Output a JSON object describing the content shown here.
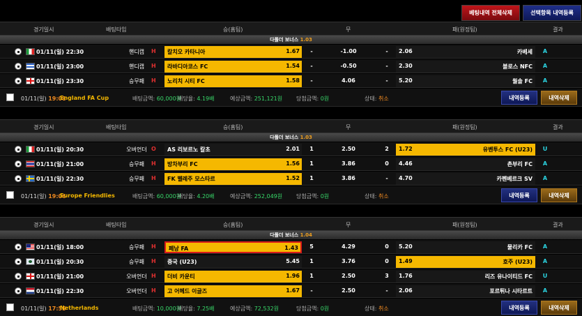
{
  "top_buttons": {
    "delete_all": "베팅내역 전체삭제",
    "register_selected": "선택항목 내역등록"
  },
  "header": {
    "date": "경기일시",
    "bet_type": "배팅타입",
    "home": "승(홈팀)",
    "draw": "무",
    "away": "패(원정팀)",
    "result": "결과"
  },
  "slips": [
    {
      "bonus_label": "다폴더 보너스",
      "bonus_value": "1.03",
      "rows": [
        {
          "flag": "it",
          "time": "01/11(일) 22:30",
          "type": "핸디캡",
          "mark": "H",
          "home": "칼치오 카타니아",
          "home_odds": "1.67",
          "mid1": "-",
          "draw": "-1.00",
          "mid2": "-",
          "away_odds": "2.06",
          "away": "카베세",
          "result": "A",
          "pick": "home"
        },
        {
          "flag": "gr",
          "time": "01/11(일) 23:00",
          "type": "핸디캡",
          "mark": "H",
          "home": "라바디아코스 FC",
          "home_odds": "1.54",
          "mid1": "-",
          "draw": "-0.50",
          "mid2": "-",
          "away_odds": "2.30",
          "away": "볼로스 NFC",
          "result": "A",
          "pick": "home"
        },
        {
          "flag": "en",
          "time": "01/11(일) 23:30",
          "type": "승무패",
          "mark": "H",
          "home": "노리치 시티 FC",
          "home_odds": "1.58",
          "mid1": "-",
          "draw": "4.06",
          "mid2": "-",
          "away_odds": "5.20",
          "away": "월솔 FC",
          "result": "A",
          "pick": "home"
        }
      ],
      "footer": {
        "date": "01/11(일)",
        "time": "19:08",
        "league": "England FA Cup",
        "bet_label": "배팅금액:",
        "bet_amount": "60,000원",
        "odds_label": "배당율:",
        "odds": "4.19배",
        "expect_label": "예상금액:",
        "expect": "251,121원",
        "win_label": "당첨금액:",
        "win": "0원",
        "state_label": "상태:",
        "state": "취소",
        "reg_button": "내역등록",
        "del_button": "내역삭제"
      }
    },
    {
      "bonus_label": "다폴더 보너스",
      "bonus_value": "1.03",
      "rows": [
        {
          "flag": "it",
          "time": "01/11(일) 20:30",
          "type": "오버언더",
          "mark": "O",
          "home": "AS 리보르노 칼초",
          "home_odds": "2.01",
          "mid1": "1",
          "draw": "2.50",
          "mid2": "2",
          "away_odds": "1.72",
          "away": "유벤투스 FC (U23)",
          "result": "U",
          "pick": "away"
        },
        {
          "flag": "th",
          "time": "01/11(일) 21:00",
          "type": "승무패",
          "mark": "H",
          "home": "방차부리 FC",
          "home_odds": "1.56",
          "mid1": "1",
          "draw": "3.86",
          "mid2": "0",
          "away_odds": "4.46",
          "away": "촌부리 FC",
          "result": "A",
          "pick": "home"
        },
        {
          "flag": "se",
          "time": "01/11(일) 22:30",
          "type": "승무패",
          "mark": "H",
          "home": "FK 벨레주 모스타르",
          "home_odds": "1.52",
          "mid1": "1",
          "draw": "3.86",
          "mid2": "-",
          "away_odds": "4.70",
          "away": "카펜베르크 SV",
          "result": "A",
          "pick": "home"
        }
      ],
      "footer": {
        "date": "01/11(일)",
        "time": "19:06",
        "league": "Europe Friendlies",
        "bet_label": "배팅금액:",
        "bet_amount": "60,000원",
        "odds_label": "배당율:",
        "odds": "4.20배",
        "expect_label": "예상금액:",
        "expect": "252,049원",
        "win_label": "당첨금액:",
        "win": "0원",
        "state_label": "상태:",
        "state": "취소",
        "reg_button": "내역등록",
        "del_button": "내역삭제"
      }
    },
    {
      "bonus_label": "다폴더 보너스",
      "bonus_value": "1.04",
      "rows": [
        {
          "flag": "my",
          "time": "01/11(일) 18:00",
          "type": "승무패",
          "mark": "H",
          "home": "페낭 FA",
          "home_odds": "1.43",
          "mid1": "5",
          "draw": "4.29",
          "mid2": "0",
          "away_odds": "5.20",
          "away": "물리카 FC",
          "result": "A",
          "pick": "home-red"
        },
        {
          "flag": "cn",
          "time": "01/11(일) 20:30",
          "type": "승무패",
          "mark": "H",
          "home": "중국 (U23)",
          "home_odds": "5.45",
          "mid1": "1",
          "draw": "3.76",
          "mid2": "0",
          "away_odds": "1.49",
          "away": "호주 (U23)",
          "result": "A",
          "pick": "away"
        },
        {
          "flag": "en",
          "time": "01/11(일) 21:00",
          "type": "오버언더",
          "mark": "H",
          "home": "더비 카운티",
          "home_odds": "1.96",
          "mid1": "1",
          "draw": "2.50",
          "mid2": "3",
          "away_odds": "1.76",
          "away": "리즈 유나이티드 FC",
          "result": "U",
          "pick": "home"
        },
        {
          "flag": "nl",
          "time": "01/11(일) 22:30",
          "type": "오버언더",
          "mark": "H",
          "home": "고 어헤드 이글즈",
          "home_odds": "1.67",
          "mid1": "-",
          "draw": "2.50",
          "mid2": "-",
          "away_odds": "2.06",
          "away": "포르튀나 시타르트",
          "result": "A",
          "pick": "home"
        }
      ],
      "footer": {
        "date": "01/11(일)",
        "time": "17:55",
        "league": "Netherlands",
        "bet_label": "배팅금액:",
        "bet_amount": "10,000원",
        "odds_label": "배당율:",
        "odds": "7.25배",
        "expect_label": "예상금액:",
        "expect": "72,532원",
        "win_label": "당첨금액:",
        "win": "0원",
        "state_label": "상태:",
        "state": "취소",
        "reg_button": "내역등록",
        "del_button": "내역삭제"
      }
    }
  ]
}
